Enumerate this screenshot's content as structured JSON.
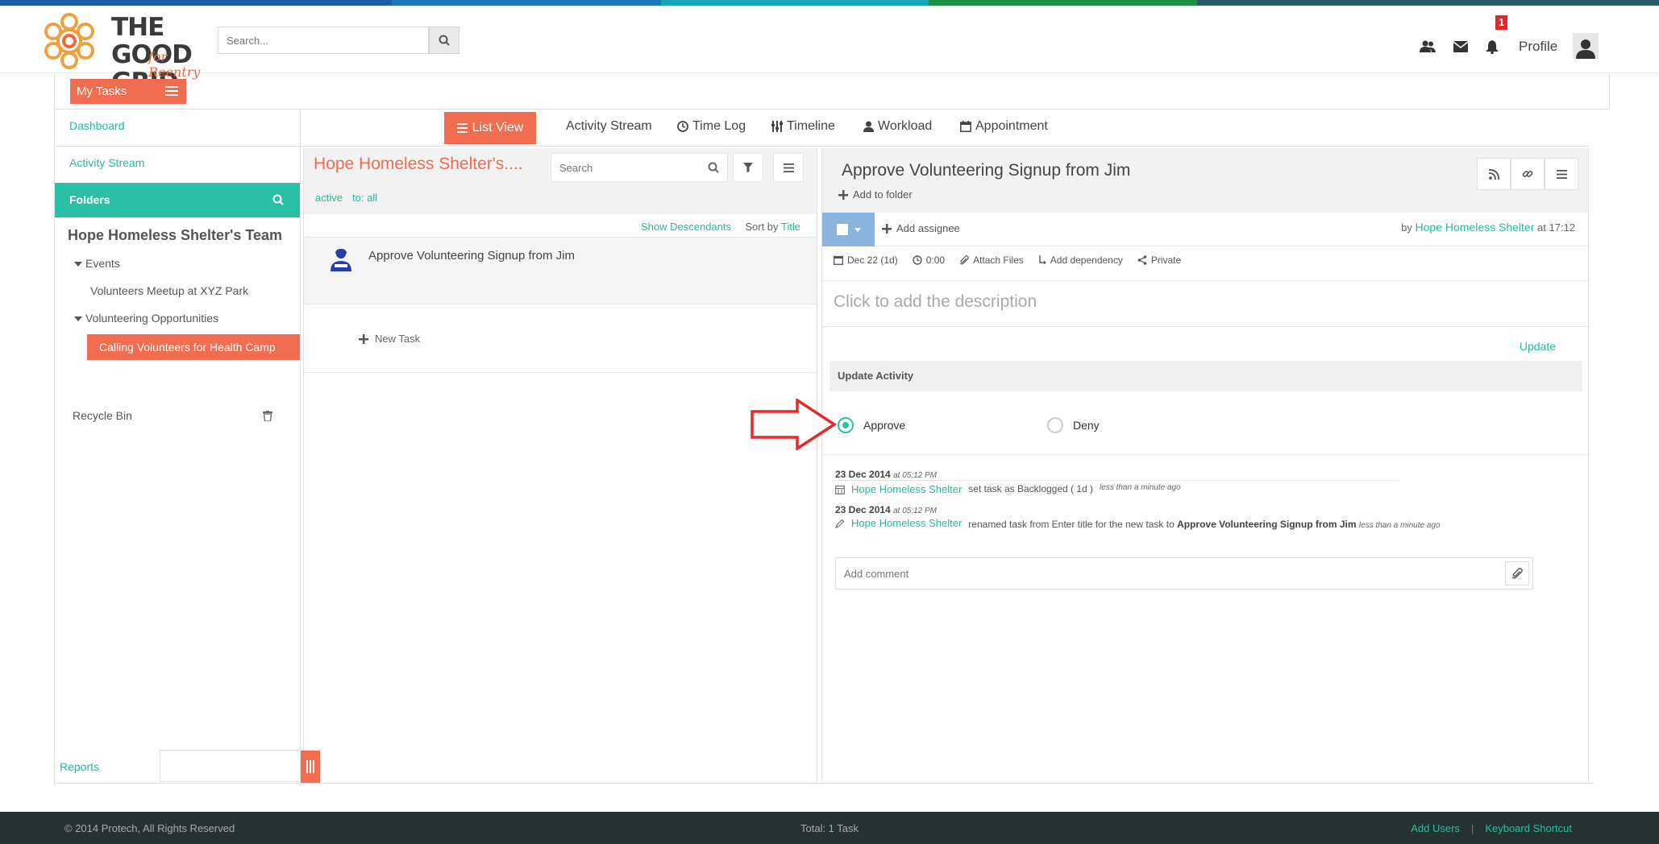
{
  "colors": {
    "accent": "#f26c4f",
    "teal": "#2cbfa8",
    "link": "#26b8a3",
    "footer": "#263232",
    "strip": [
      "#1a5ea8",
      "#1b78b9",
      "#19a3b6",
      "#1f8f46",
      "#2a5a6a"
    ]
  },
  "header": {
    "logo_text_line1": "THE GOOD",
    "logo_text_line2": "GRID",
    "logo_sub": "for Reentry",
    "search_placeholder": "Search...",
    "icons": [
      "users-icon",
      "envelope-icon",
      "bell-icon"
    ],
    "notification_count": "1",
    "profile_label": "Profile"
  },
  "toolbar": {
    "my_tasks_label": "My Tasks"
  },
  "sidebar": {
    "dashboard": "Dashboard",
    "activity_stream": "Activity Stream",
    "folders": "Folders",
    "team_title": "Hope Homeless Shelter's Team",
    "tree": {
      "events": "Events",
      "event_item": "Volunteers Meetup at XYZ Park",
      "volunteering": "Volunteering Opportunities",
      "active_item": "Calling Volunteers for Health Camp"
    },
    "recycle_bin": "Recycle Bin",
    "reports": "Reports"
  },
  "tabs": {
    "list_view": "List View",
    "activity_stream": "Activity Stream",
    "time_log": "Time Log",
    "timeline": "Timeline",
    "workload": "Workload",
    "appointment": "Appointment"
  },
  "list": {
    "title": "Hope Homeless Shelter's....",
    "search_placeholder": "Search",
    "chip_active": "active",
    "chip_to": "to: all",
    "show_descendants": "Show Descendants",
    "sort_by_label": "Sort by",
    "sort_by_value": "Title",
    "task_title": "Approve Volunteering Signup from Jim",
    "new_task": "New Task"
  },
  "detail": {
    "title": "Approve Volunteering Signup from Jim",
    "add_to_folder": "Add to folder",
    "add_assignee": "Add assignee",
    "by_label": "by",
    "by_name": "Hope Homeless Shelter",
    "by_time": "at 17:12",
    "meta": {
      "date": "Dec 22 (1d)",
      "time": "0:00",
      "attach": "Attach Files",
      "dependency": "Add dependency",
      "privacy": "Private"
    },
    "description_placeholder": "Click to add the description",
    "update": "Update",
    "update_activity": "Update Activity",
    "approve": "Approve",
    "deny": "Deny",
    "selected_option": "Approve",
    "activity": [
      {
        "date": "23 Dec 2014",
        "time": "at 05:12 PM",
        "user": "Hope Homeless Shelter",
        "text": "set task as Backlogged ( 1d )",
        "ago": "less than a minute ago"
      },
      {
        "date": "23 Dec 2014",
        "time": "at 05:12 PM",
        "user": "Hope Homeless Shelter",
        "text": "renamed task from Enter title for the new task to",
        "bold": "Approve Volunteering Signup from Jim",
        "ago": "less than a minute ago"
      }
    ],
    "comment_placeholder": "Add comment"
  },
  "footer": {
    "copyright": "© 2014 Protech, All Rights Reserved",
    "total": "Total: 1 Task",
    "add_users": "Add Users",
    "separator": "|",
    "keyboard": "Keyboard Shortcut"
  }
}
